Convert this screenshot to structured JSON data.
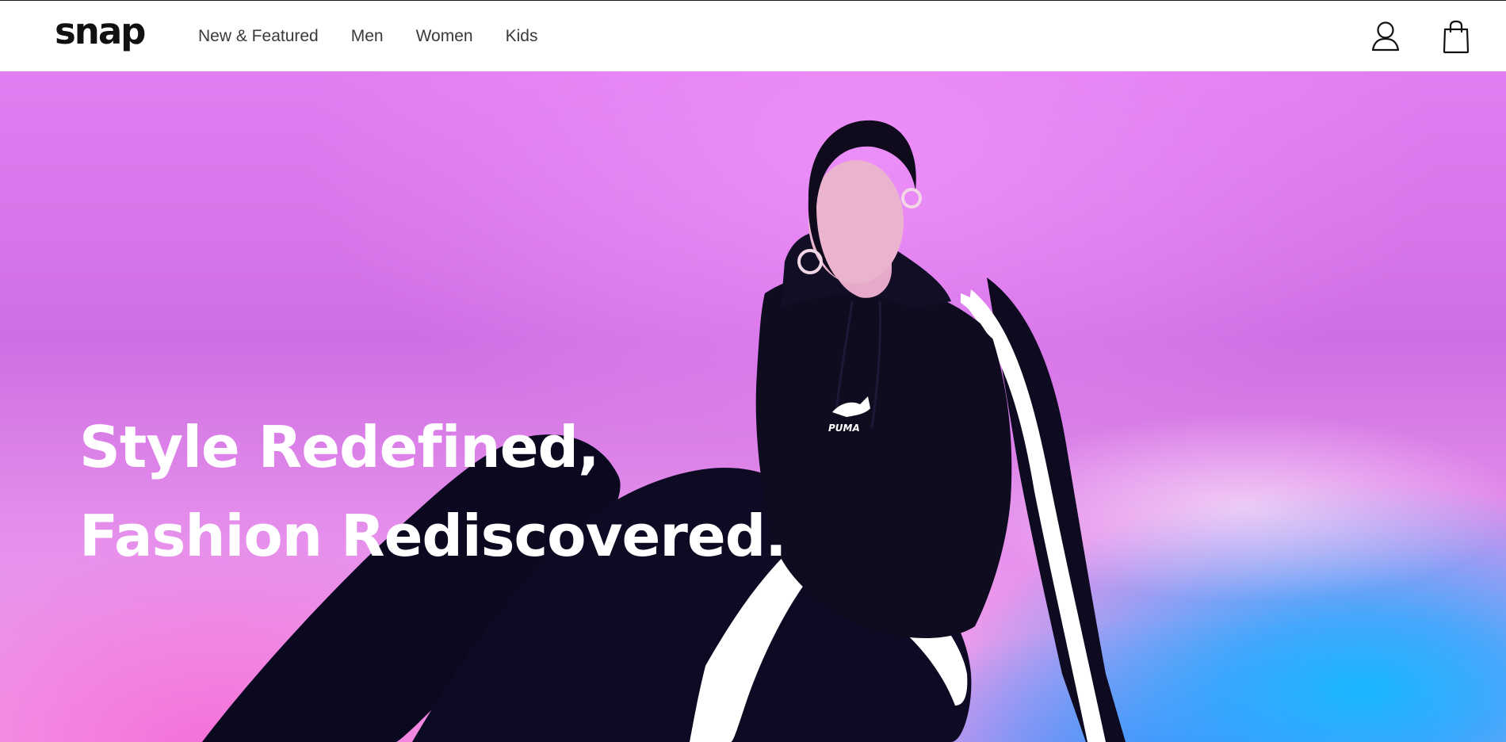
{
  "header": {
    "logo": "snap",
    "nav": [
      {
        "label": "New & Featured"
      },
      {
        "label": "Men"
      },
      {
        "label": "Women"
      },
      {
        "label": "Kids"
      }
    ],
    "icons": {
      "account": "user-icon",
      "bag": "shopping-bag-icon"
    }
  },
  "hero": {
    "headline_line1": "Style Redefined,",
    "headline_line2": "Fashion Rediscovered.",
    "brand_mark": "PUMA",
    "colors": {
      "background_magenta": "#e27df2",
      "background_pink": "#f46ed8",
      "background_blue": "#19b6ff",
      "headline": "#ffffff"
    }
  }
}
